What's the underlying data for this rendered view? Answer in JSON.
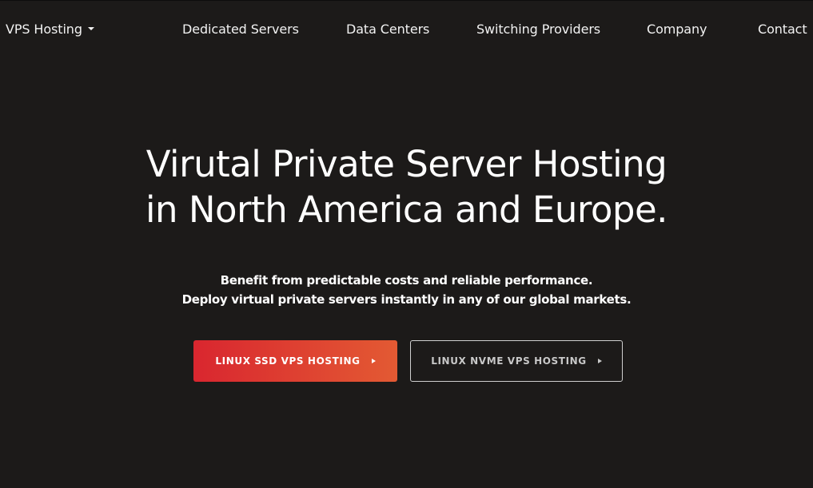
{
  "nav": {
    "items": [
      {
        "label": "VPS Hosting",
        "has_dropdown": true
      },
      {
        "label": "Dedicated Servers"
      },
      {
        "label": "Data Centers"
      },
      {
        "label": "Switching Providers"
      },
      {
        "label": "Company"
      },
      {
        "label": "Contact"
      }
    ]
  },
  "hero": {
    "title_line1": "Virutal Private Server Hosting",
    "title_line2": "in North America and Europe.",
    "subtitle_line1": "Benefit from predictable costs and reliable performance.",
    "subtitle_line2": "Deploy virtual private servers instantly in any of our global markets."
  },
  "buttons": {
    "primary_label": "LINUX SSD VPS HOSTING",
    "secondary_label": "LINUX NVME VPS HOSTING"
  },
  "icons": {
    "dropdown": "caret-down-icon",
    "button_arrow": "play-triangle-icon"
  },
  "colors": {
    "background": "#1c1a19",
    "primary_gradient_start": "#d9262f",
    "primary_gradient_end": "#e35a33",
    "secondary_border": "#cfcfcf"
  }
}
